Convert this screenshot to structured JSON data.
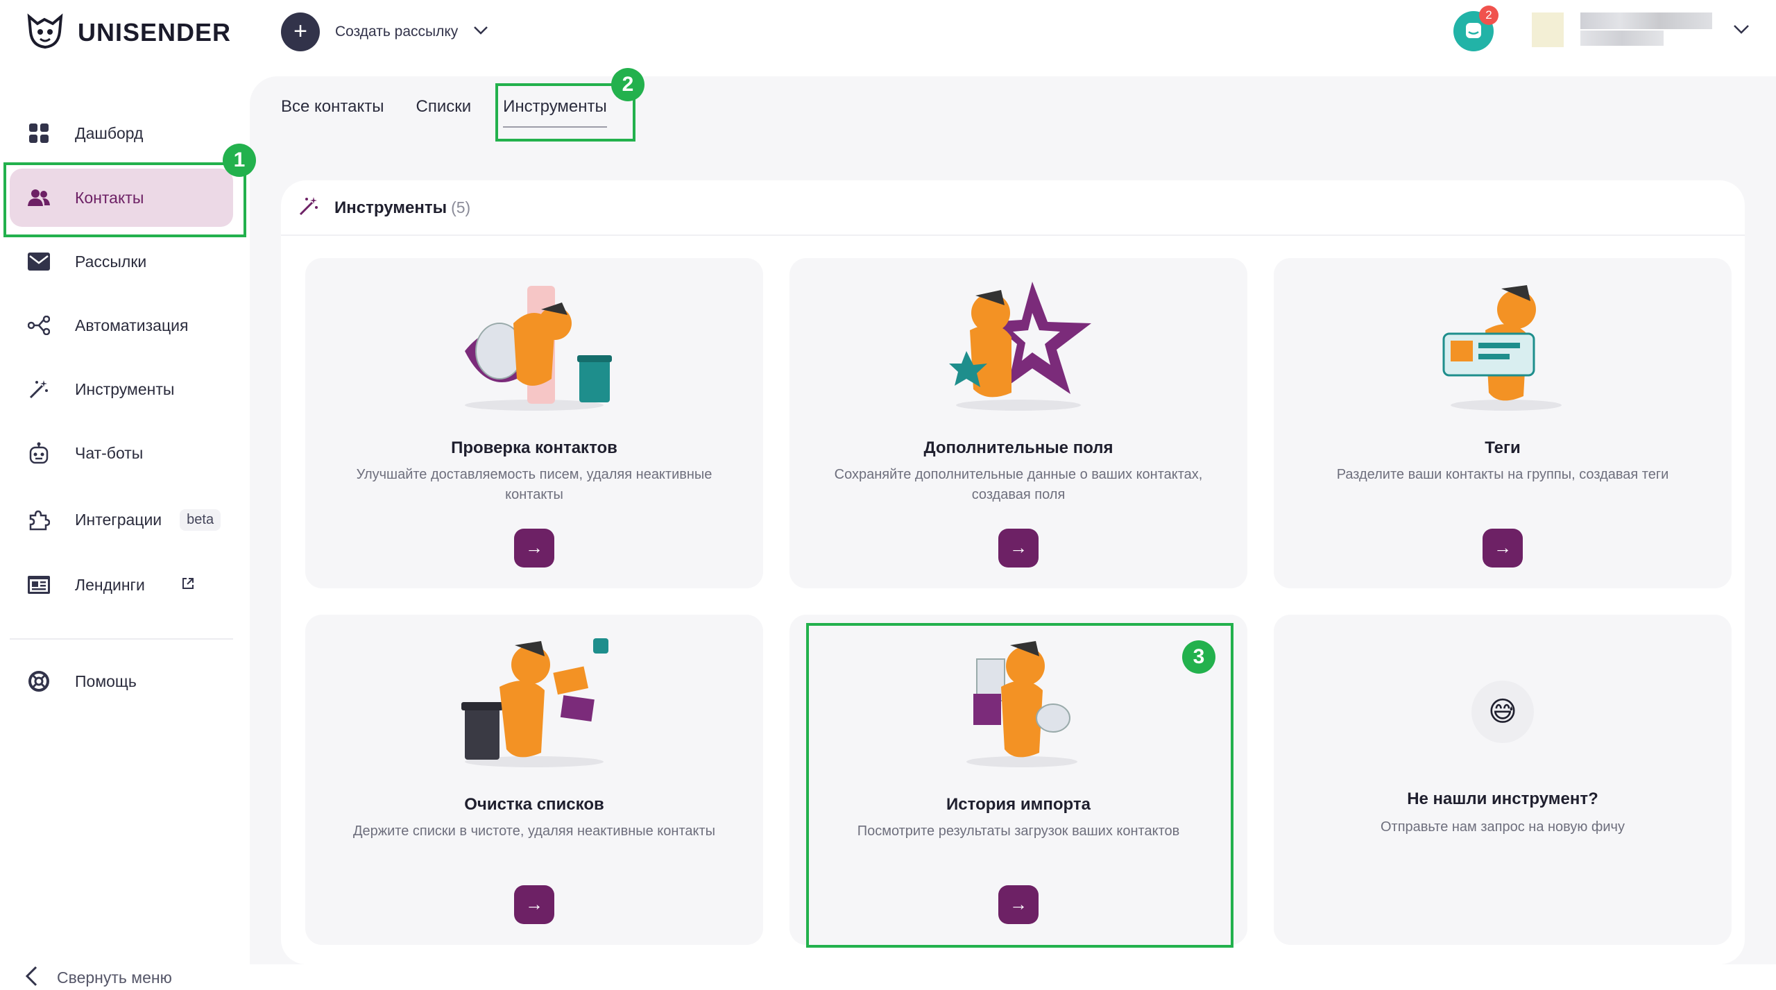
{
  "brand": {
    "name": "UNISENDER",
    "accent": "#6d2165",
    "highlight": "#23b14d"
  },
  "topbar": {
    "create_label": "Создать рассылку",
    "chat_badge": "2"
  },
  "sidebar": {
    "items": [
      {
        "label": "Дашборд",
        "icon": "dashboard-icon"
      },
      {
        "label": "Контакты",
        "icon": "contacts-icon",
        "active": true
      },
      {
        "label": "Рассылки",
        "icon": "mail-icon"
      },
      {
        "label": "Автоматизация",
        "icon": "automation-icon"
      },
      {
        "label": "Инструменты",
        "icon": "magic-wand-icon"
      },
      {
        "label": "Чат-боты",
        "icon": "bot-icon"
      },
      {
        "label": "Интеграции",
        "icon": "puzzle-icon",
        "badge": "beta"
      },
      {
        "label": "Лендинги",
        "icon": "landing-icon",
        "external": true
      },
      {
        "label": "Помощь",
        "icon": "help-icon"
      }
    ],
    "collapse_label": "Свернуть меню"
  },
  "tabs": [
    {
      "label": "Все контакты"
    },
    {
      "label": "Списки"
    },
    {
      "label": "Инструменты",
      "active": true
    }
  ],
  "panel": {
    "title": "Инструменты",
    "count": "(5)"
  },
  "cards": [
    {
      "title": "Проверка контактов",
      "desc": "Улучшайте доставляемость писем, удаляя неактивные контакты",
      "button": "→"
    },
    {
      "title": "Дополнительные поля",
      "desc": "Сохраняйте дополнительные данные о ваших контактах, создавая поля",
      "button": "→"
    },
    {
      "title": "Теги",
      "desc": "Разделите ваши контакты на группы, создавая теги",
      "button": "→"
    },
    {
      "title": "Очистка списков",
      "desc": "Держите списки в чистоте, удаляя неактивные контакты",
      "button": "→"
    },
    {
      "title": "История импорта",
      "desc": "Посмотрите результаты загрузок ваших контактов",
      "button": "→"
    },
    {
      "title": "Не нашли инструмент?",
      "desc": "Отправьте нам запрос на новую фичу",
      "emoji": "😅"
    }
  ],
  "annotations": [
    "1",
    "2",
    "3"
  ]
}
